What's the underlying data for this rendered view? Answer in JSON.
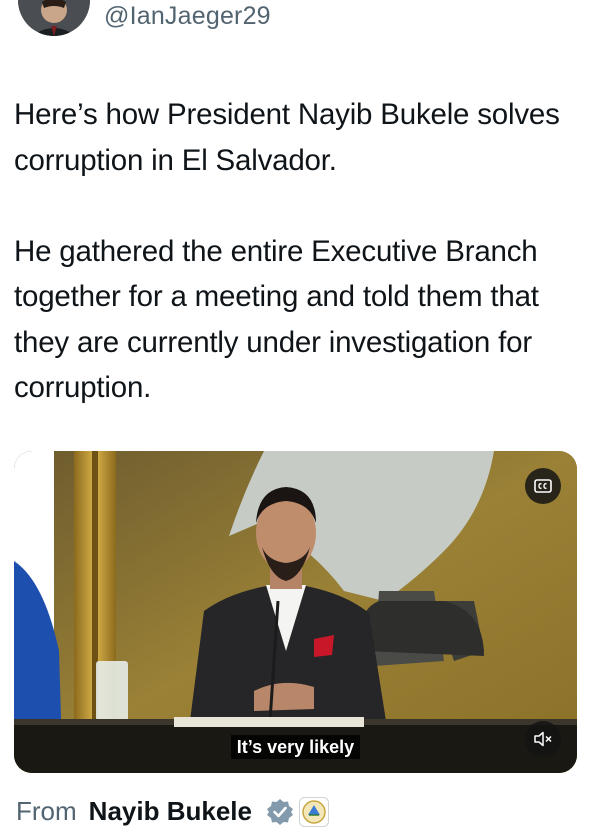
{
  "header": {
    "handle": "@IanJaeger29"
  },
  "tweet": {
    "paragraphs": [
      "Here’s how President Nayib Bukele solves corruption in El Salvador.",
      "He gathered the entire Executive Branch together for a meeting and told them that they are currently under investigation for corruption."
    ]
  },
  "video": {
    "caption": "It’s very likely",
    "icons": {
      "cc": "closed-captions-icon",
      "mute": "muted-speaker-icon"
    }
  },
  "source": {
    "from_label": "From",
    "name": "Nayib Bukele",
    "verified_icon": "verified-badge-icon",
    "affiliation_icon": "government-seal-icon",
    "verified_color": "#829aab"
  }
}
